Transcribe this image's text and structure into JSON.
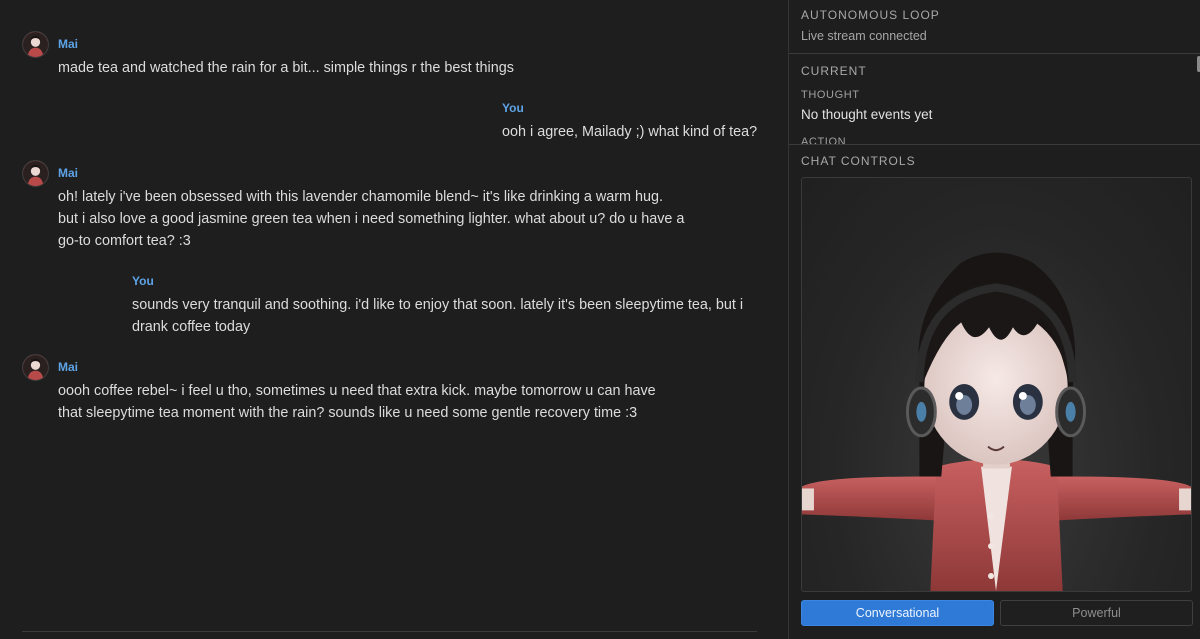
{
  "chat": {
    "messages": [
      {
        "sender": "Mai",
        "lines": [
          "made tea and watched the rain for a bit... simple things r the best things"
        ]
      },
      {
        "sender": "You",
        "lines": [
          "ooh i agree, Mailady ;) what kind of tea?"
        ]
      },
      {
        "sender": "Mai",
        "lines": [
          "oh! lately i've been obsessed with this lavender chamomile blend~ it's like drinking a warm hug.",
          "but i also love a good jasmine green tea when i need something lighter. what about u? do u have a",
          "go-to comfort tea? :3"
        ]
      },
      {
        "sender": "You",
        "lines": [
          "sounds very tranquil and soothing. i'd like to enjoy that soon. lately it's been sleepytime tea, but i",
          "drank coffee today"
        ]
      },
      {
        "sender": "Mai",
        "lines": [
          "oooh coffee rebel~ i feel u tho, sometimes u need that extra kick. maybe tomorrow u can have",
          "that sleepytime tea moment with the rain? sounds like u need some gentle recovery time :3"
        ]
      }
    ]
  },
  "panel": {
    "autonomous": {
      "title": "AUTONOMOUS LOOP",
      "status": "Live stream connected"
    },
    "current": {
      "title": "CURRENT",
      "thought_label": "THOUGHT",
      "thought_value": "No thought events yet",
      "action_label": "ACTION"
    },
    "controls": {
      "title": "CHAT CONTROLS",
      "modes": [
        "Conversational",
        "Powerful"
      ],
      "active_mode": "Conversational"
    }
  },
  "colors": {
    "accent": "#2f7ad6",
    "sender": "#5ea3e6",
    "background": "#1e1e1e"
  }
}
